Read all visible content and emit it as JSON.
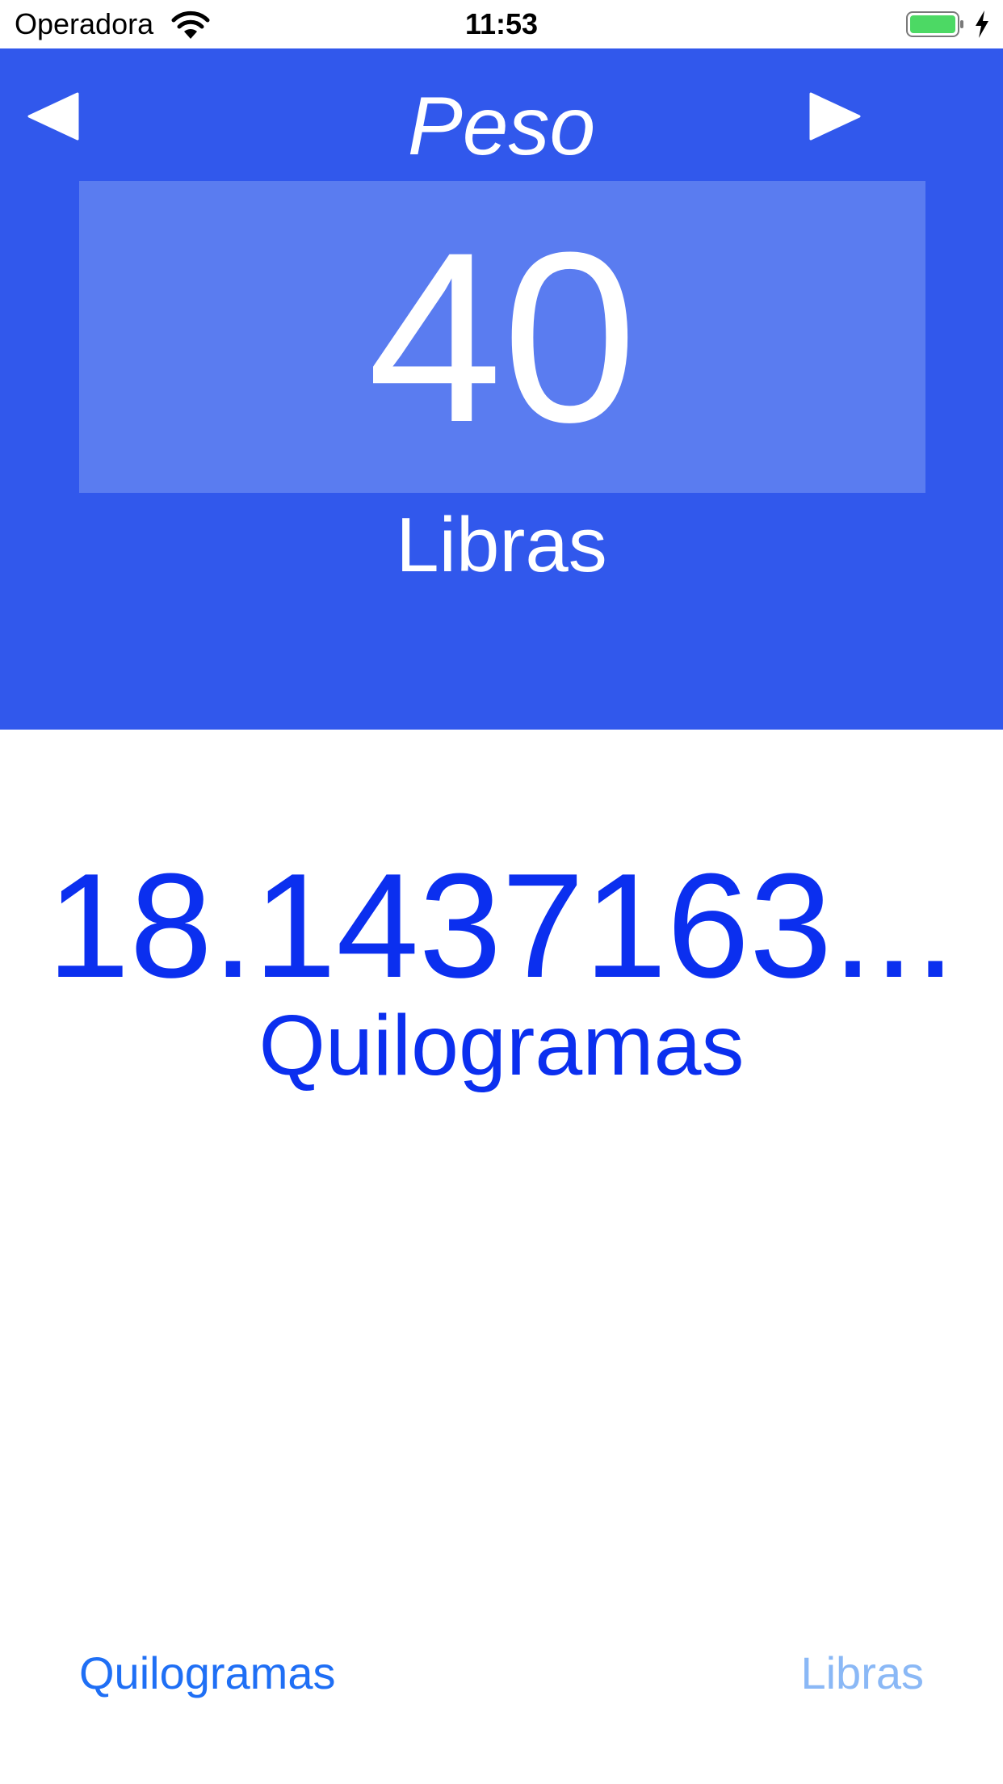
{
  "status_bar": {
    "carrier": "Operadora",
    "time": "11:53",
    "battery_color": "#4cd964"
  },
  "header": {
    "title": "Peso",
    "prev_icon": "triangle-left-icon",
    "next_icon": "triangle-right-icon",
    "background": "#3158ec"
  },
  "input": {
    "value": "40",
    "unit": "Libras"
  },
  "result": {
    "value": "18.1437163...",
    "unit": "Quilogramas",
    "color": "#0b2fef"
  },
  "unit_selector": {
    "left_label": "Quilogramas",
    "right_label": "Libras"
  }
}
